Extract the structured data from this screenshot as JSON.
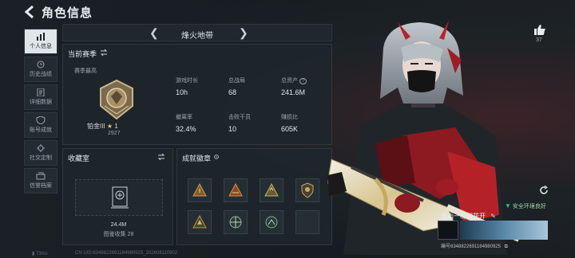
{
  "header": {
    "title": "角色信息"
  },
  "sidebar": {
    "items": [
      {
        "label": "个人信息",
        "active": true
      },
      {
        "label": "历史战绩"
      },
      {
        "label": "详细数据"
      },
      {
        "label": "账号成就"
      },
      {
        "label": "社交定制"
      },
      {
        "label": "信誉档案"
      }
    ]
  },
  "map": {
    "name": "烽火地带"
  },
  "season": {
    "title": "当前赛季",
    "best_label": "赛季最高",
    "rank": "铂金III",
    "stars": "1",
    "score": "2927",
    "stats": [
      {
        "label": "游戏时长",
        "value": "10h"
      },
      {
        "label": "总战局",
        "value": "68"
      },
      {
        "label": "总资产",
        "value": "241.6M"
      },
      {
        "label": "撤离率",
        "value": "32.4%"
      },
      {
        "label": "击败干员",
        "value": "10"
      },
      {
        "label": "赚损比",
        "value": "605K"
      }
    ]
  },
  "collection": {
    "title": "收藏室",
    "value": "24.4M",
    "count_text": "图鉴收集 28"
  },
  "badges": {
    "title": "成就徽章"
  },
  "likes": {
    "count": "37"
  },
  "environment": {
    "status": "安全环境良好"
  },
  "player": {
    "name": "邂逅一株梨花开",
    "uid": "编号6348822691184980925"
  },
  "footer": {
    "latency": "73ms",
    "uid": "CN UID:6348822691184980925_202608110602"
  },
  "colors": {
    "accent": "#dfe5e9",
    "panel": "#1e262c",
    "safe": "#2fc774"
  }
}
